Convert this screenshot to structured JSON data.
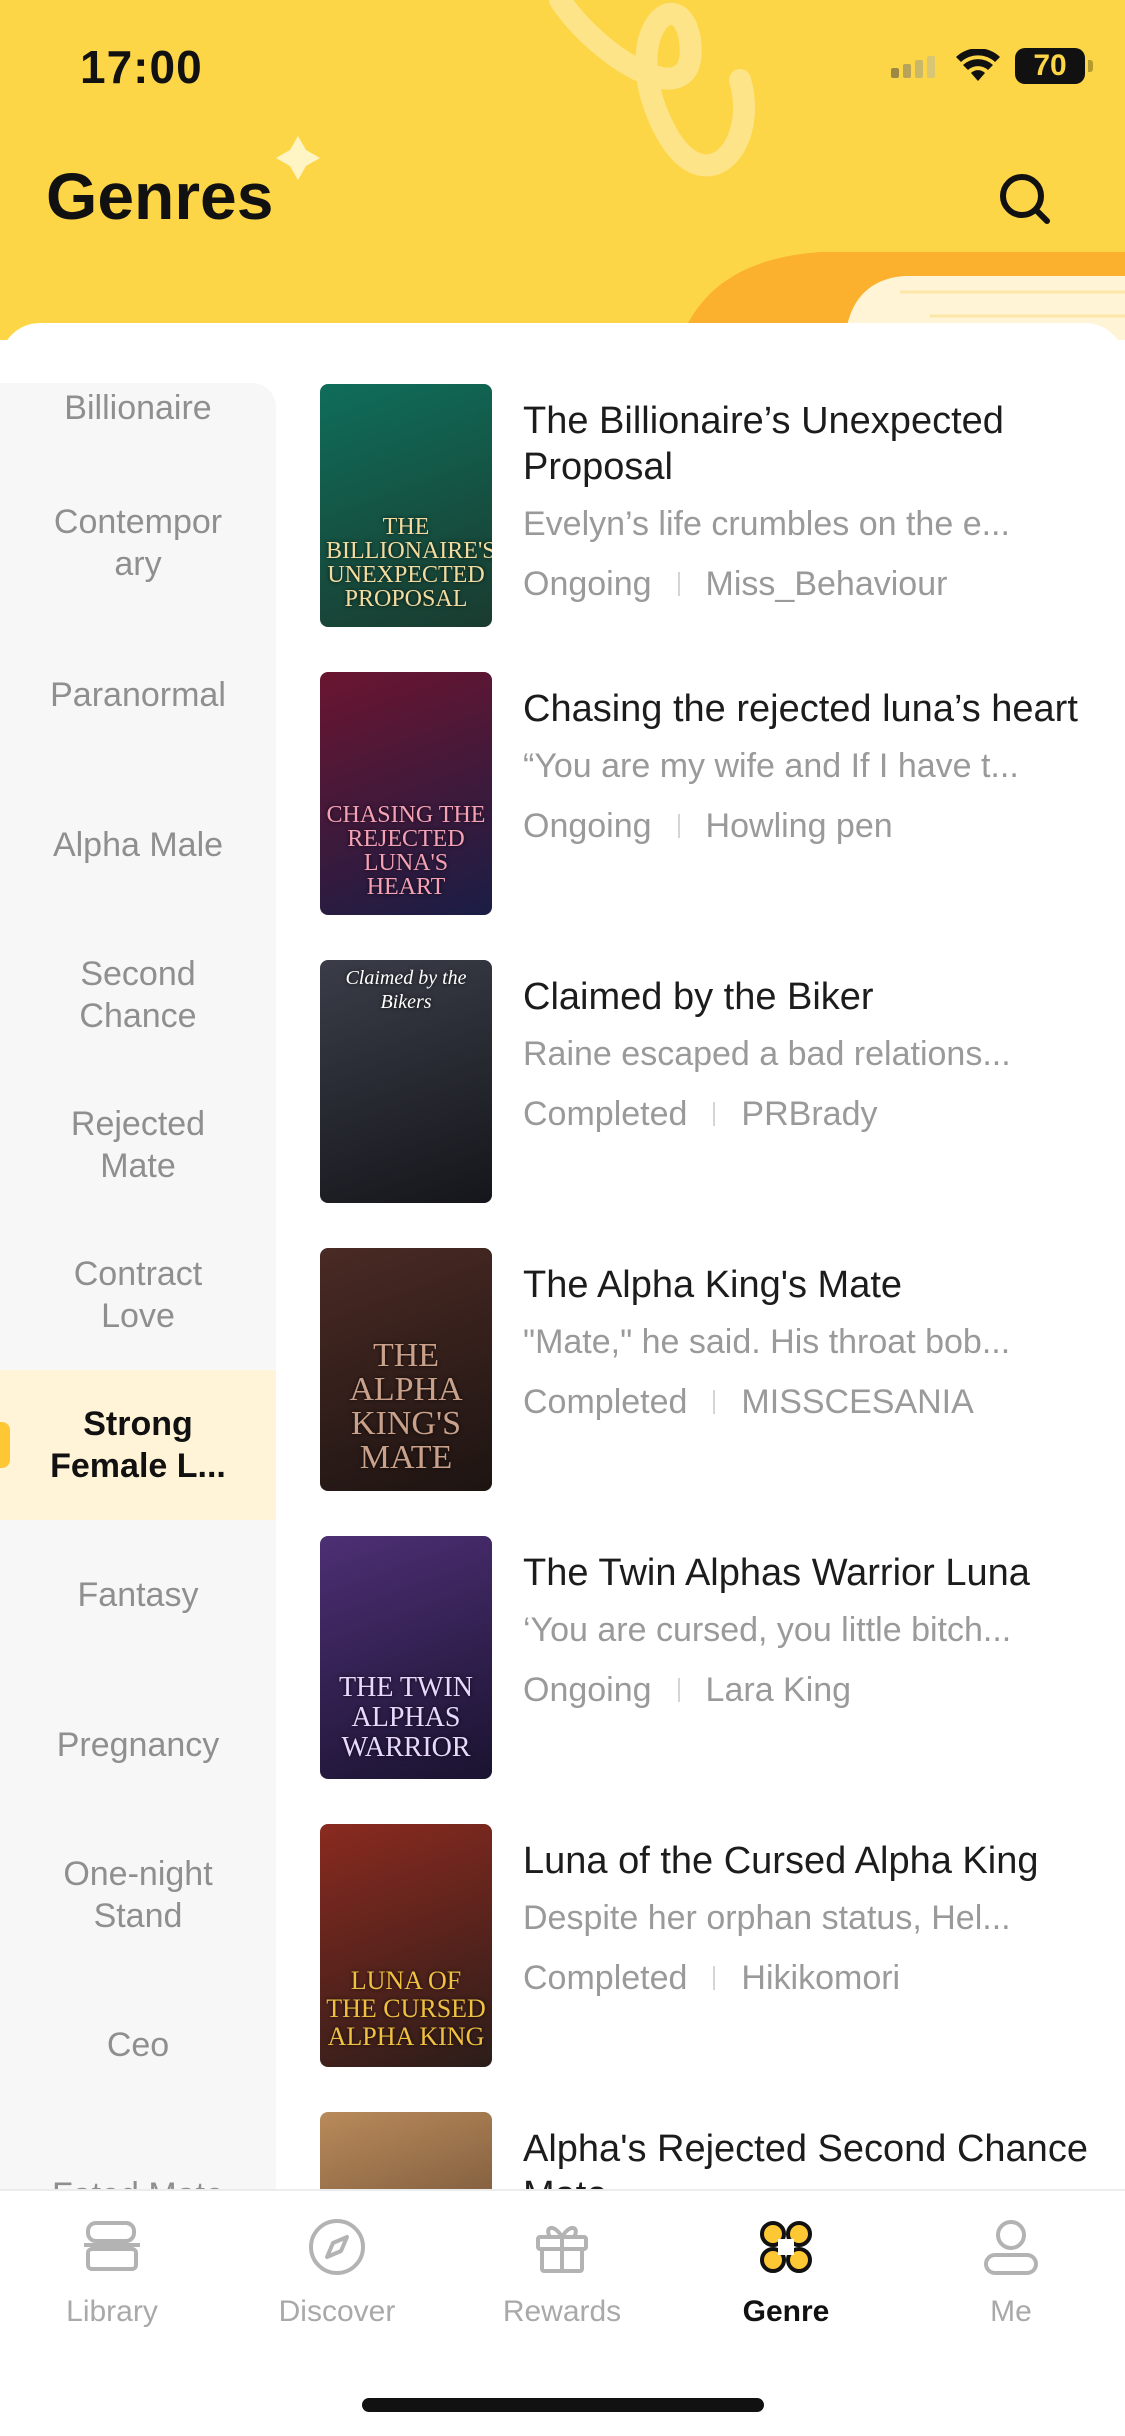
{
  "status_bar": {
    "time": "17:00",
    "battery": "70"
  },
  "header": {
    "title": "Genres"
  },
  "colors": {
    "accent": "#fdd648",
    "active_tab_icon": "#fdc833"
  },
  "sidebar": {
    "items": [
      {
        "label": "Billionaire",
        "active": false
      },
      {
        "label": "Contemporary",
        "active": false
      },
      {
        "label": "Paranormal",
        "active": false
      },
      {
        "label": "Alpha Male",
        "active": false
      },
      {
        "label": "Second Chance",
        "active": false
      },
      {
        "label": "Rejected Mate",
        "active": false
      },
      {
        "label": "Contract Love",
        "active": false
      },
      {
        "label": "Strong Female L...",
        "active": true
      },
      {
        "label": "Fantasy",
        "active": false
      },
      {
        "label": "Pregnancy",
        "active": false
      },
      {
        "label": "One-night Stand",
        "active": false
      },
      {
        "label": "Ceo",
        "active": false
      },
      {
        "label": "Fated Mate",
        "active": false
      }
    ]
  },
  "books": [
    {
      "title": "The Billionaire’s Unexpected Proposal",
      "desc": "Evelyn’s life crumbles on the e...",
      "status": "Ongoing",
      "author": "Miss_Behaviour",
      "cover_text": "The Billionaire's Unexpected Proposal",
      "cover_colors": [
        "#0f6d5a",
        "#1a3b2f"
      ]
    },
    {
      "title": "Chasing the rejected luna’s heart",
      "desc": "“You are my wife and If I have t...",
      "status": "Ongoing",
      "author": "Howling pen",
      "cover_text": "Chasing the Rejected Luna's Heart",
      "cover_colors": [
        "#6b1530",
        "#1a1d45"
      ]
    },
    {
      "title": "Claimed by the Biker",
      "desc": "Raine escaped a bad relations...",
      "status": "Completed",
      "author": "PRBrady",
      "cover_text": "Claimed by the Bikers",
      "cover_colors": [
        "#3a3d48",
        "#15161b"
      ]
    },
    {
      "title": "The Alpha King's Mate",
      "desc": "\"Mate,\" he said. His throat bob...",
      "status": "Completed",
      "author": "MISSCESANIA",
      "cover_text": "The Alpha King's Mate",
      "cover_colors": [
        "#4a2a24",
        "#1d1412"
      ]
    },
    {
      "title": "The Twin Alphas Warrior Luna",
      "desc": "‘You are cursed, you little bitch...",
      "status": "Ongoing",
      "author": "Lara King",
      "cover_text": "The Twin Alphas Warrior",
      "cover_colors": [
        "#4d2f74",
        "#1a1330"
      ]
    },
    {
      "title": "Luna of the Cursed Alpha King",
      "desc": "Despite her orphan status, Hel...",
      "status": "Completed",
      "author": "Hikikomori",
      "cover_text": "Luna of the Cursed Alpha King",
      "cover_colors": [
        "#8a2a1f",
        "#2b1d1a"
      ]
    },
    {
      "title": "Alpha's Rejected Second Chance Mate",
      "desc": "",
      "status": "",
      "author": "",
      "cover_text": "",
      "cover_colors": [
        "#b98a5a",
        "#4a3325"
      ]
    }
  ],
  "tabbar": {
    "tabs": [
      {
        "label": "Library",
        "icon": "library-icon",
        "active": false
      },
      {
        "label": "Discover",
        "icon": "compass-icon",
        "active": false
      },
      {
        "label": "Rewards",
        "icon": "gift-icon",
        "active": false
      },
      {
        "label": "Genre",
        "icon": "genre-grid-icon",
        "active": true
      },
      {
        "label": "Me",
        "icon": "person-icon",
        "active": false
      }
    ]
  }
}
